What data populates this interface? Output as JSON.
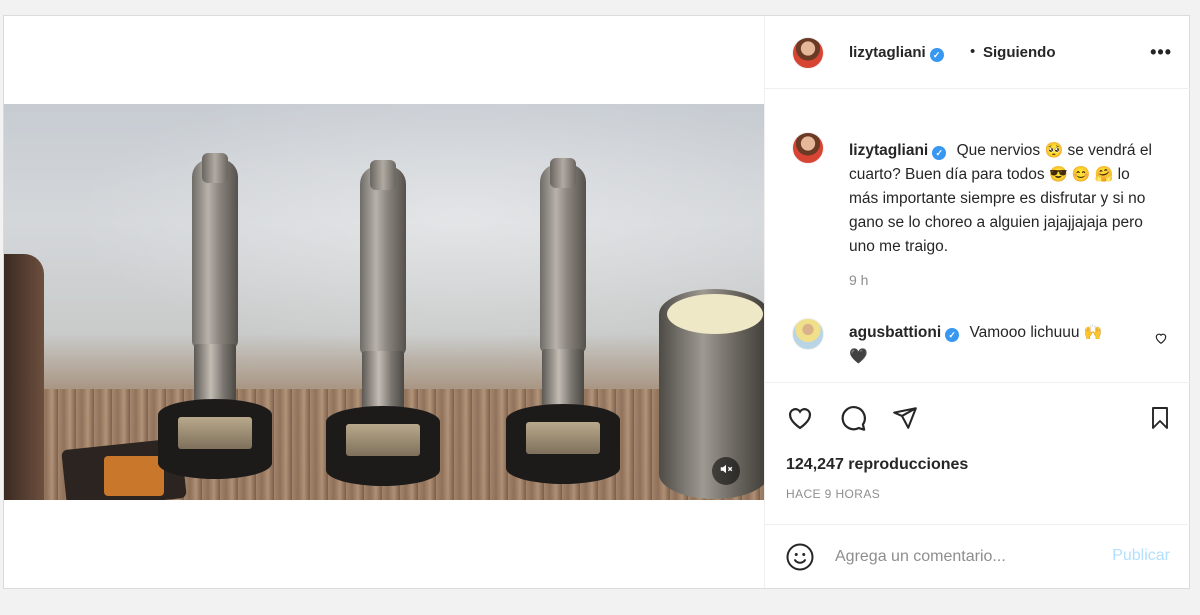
{
  "post": {
    "author": {
      "username": "lizytagliani",
      "verified": true,
      "follow_status": "Siguiendo",
      "separator": "•"
    },
    "caption": {
      "username": "lizytagliani",
      "text_part1": "Que nervios",
      "emoji1": "🥺",
      "text_part2": "se vendrá el cuarto? Buen día para todos",
      "emoji2": "😎 😊 🤗",
      "text_part3": "lo más importante siempre es disfrutar y si no gano se lo choreo a alguien jajajjajaja pero uno me traigo.",
      "time": "9 h"
    },
    "comments": [
      {
        "username": "agusbattioni",
        "verified": true,
        "text": "Vamooo lichuuu",
        "emoji": "🙌",
        "text_line2": "🖤"
      }
    ],
    "views": "124,247 reproducciones",
    "posted_ago": "HACE 9 HORAS",
    "comment_box": {
      "placeholder": "Agrega un comentario...",
      "publish_label": "Publicar"
    },
    "icons": {
      "more": "more-options-icon",
      "like": "heart-icon",
      "comment": "comment-icon",
      "share": "paper-plane-icon",
      "save": "bookmark-icon",
      "mute": "speaker-muted-icon",
      "emoji": "emoji-icon"
    }
  }
}
